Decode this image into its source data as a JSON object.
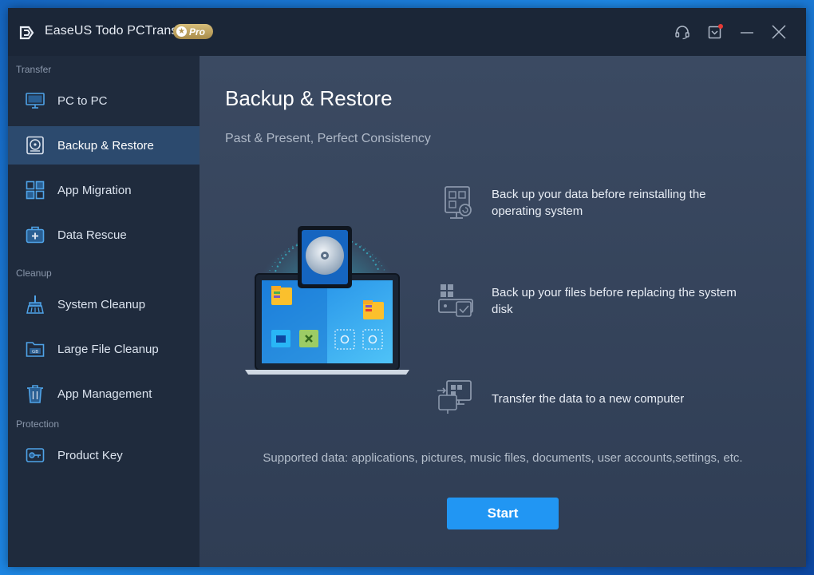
{
  "app": {
    "title": "EaseUS Todo PCTrans",
    "badge": "Pro"
  },
  "titlebar": {
    "icons": [
      "headset-icon",
      "notification-icon",
      "minimize-icon",
      "close-icon"
    ]
  },
  "sidebar": {
    "sections": [
      {
        "label": "Transfer"
      },
      {
        "label": "Cleanup"
      },
      {
        "label": "Protection"
      }
    ],
    "items": [
      {
        "label": "PC to PC",
        "icon": "monitor-icon"
      },
      {
        "label": "Backup & Restore",
        "icon": "backup-disk-icon",
        "active": true
      },
      {
        "label": "App Migration",
        "icon": "apps-grid-icon"
      },
      {
        "label": "Data Rescue",
        "icon": "rescue-kit-icon"
      },
      {
        "label": "System Cleanup",
        "icon": "broom-icon"
      },
      {
        "label": "Large File Cleanup",
        "icon": "folder-gb-icon"
      },
      {
        "label": "App Management",
        "icon": "trash-icon"
      },
      {
        "label": "Product Key",
        "icon": "key-icon"
      }
    ]
  },
  "main": {
    "title": "Backup & Restore",
    "subtitle": "Past & Present, Perfect Consistency",
    "features": [
      {
        "text": "Back up your data before reinstalling the operating system",
        "icon": "reinstall-backup-icon"
      },
      {
        "text": "Back up your files before replacing the system disk",
        "icon": "disk-replace-icon"
      },
      {
        "text": "Transfer the data to a new computer",
        "icon": "transfer-computer-icon"
      }
    ],
    "supported": "Supported data: applications, pictures, music files, documents, user accounts,settings, etc.",
    "start_label": "Start"
  },
  "colors": {
    "accent": "#2196f3",
    "sidebar_active": "#2c4a6e",
    "sidebar_bg": "#1f2b3d",
    "main_bg": "#35445b",
    "badge_gold": "#c4a864",
    "notification_dot": "#e53935"
  }
}
